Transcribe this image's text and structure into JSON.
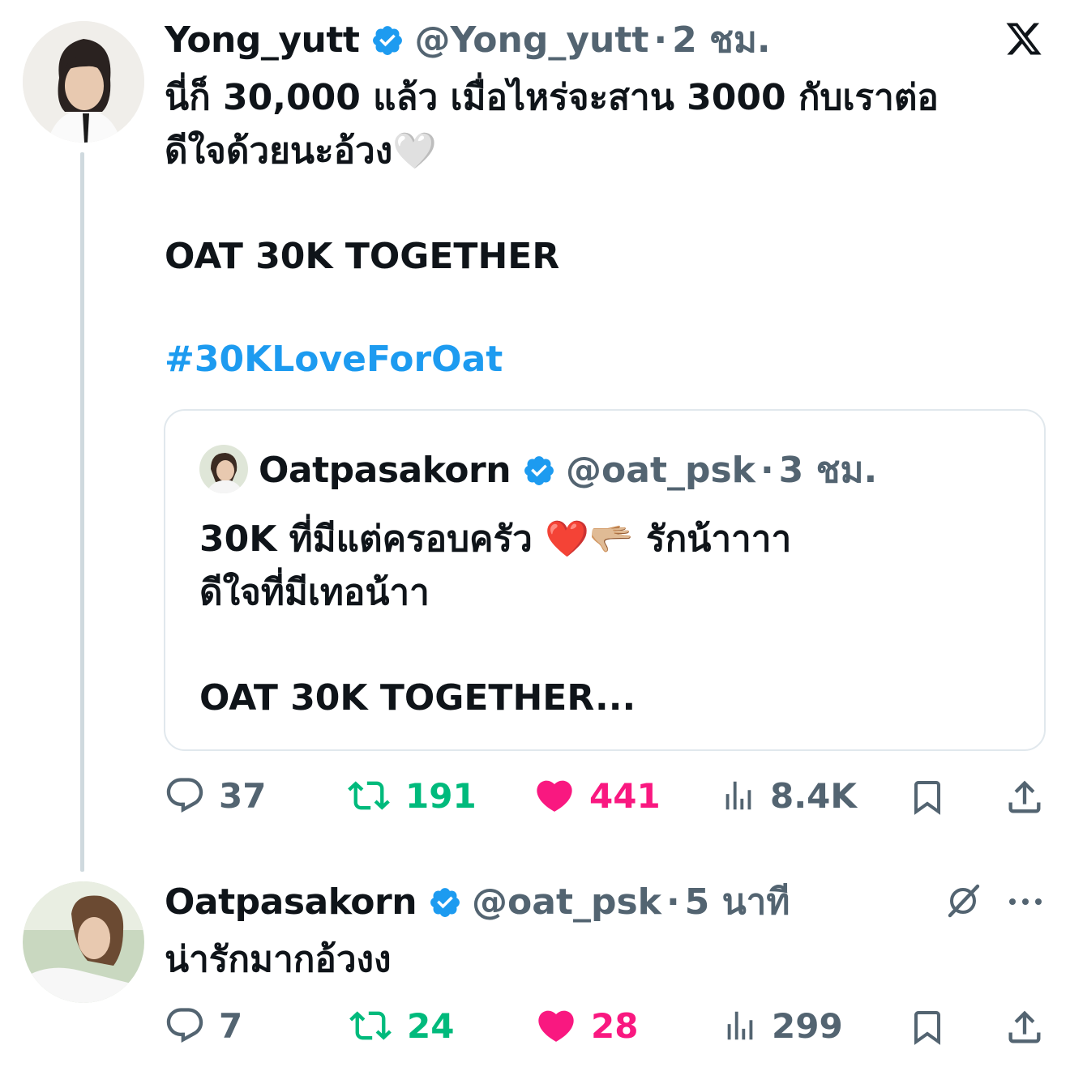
{
  "app_icon": "x-logo-icon",
  "tweet": {
    "author_name": "Yong_yutt",
    "handle": "@Yong_yutt",
    "time": "2 ชม.",
    "text_line1": "นี่ก็ 30,000 แล้ว เมื่อไหร่จะสาน 3000 กับเราต่อ",
    "text_line2": "ดีใจด้วยนะอ้วง🤍",
    "text_line3": "OAT 30K TOGETHER",
    "hashtag": "#30KLoveForOat",
    "quote": {
      "author_name": "Oatpasakorn",
      "handle": "@oat_psk",
      "time": "3 ชม.",
      "text_line1": "30K ที่มีแต่ครอบครัว ❤️🫳🏼 รักน้าาาา",
      "text_line2": "ดีใจที่มีเทอน้าา",
      "text_line3": "OAT 30K TOGETHER..."
    },
    "stats": {
      "replies": "37",
      "retweets": "191",
      "likes": "441",
      "views": "8.4K"
    }
  },
  "reply": {
    "author_name": "Oatpasakorn",
    "handle": "@oat_psk",
    "time": "5 นาที",
    "text": "น่ารักมากอ้วงง",
    "stats": {
      "replies": "7",
      "retweets": "24",
      "likes": "28",
      "views": "299"
    }
  },
  "colors": {
    "accent_blue": "#1d9bf0",
    "retweet_green": "#00ba7c",
    "like_pink": "#f91880",
    "secondary_gray": "#536471",
    "verified_blue": "#1d9bf0"
  }
}
